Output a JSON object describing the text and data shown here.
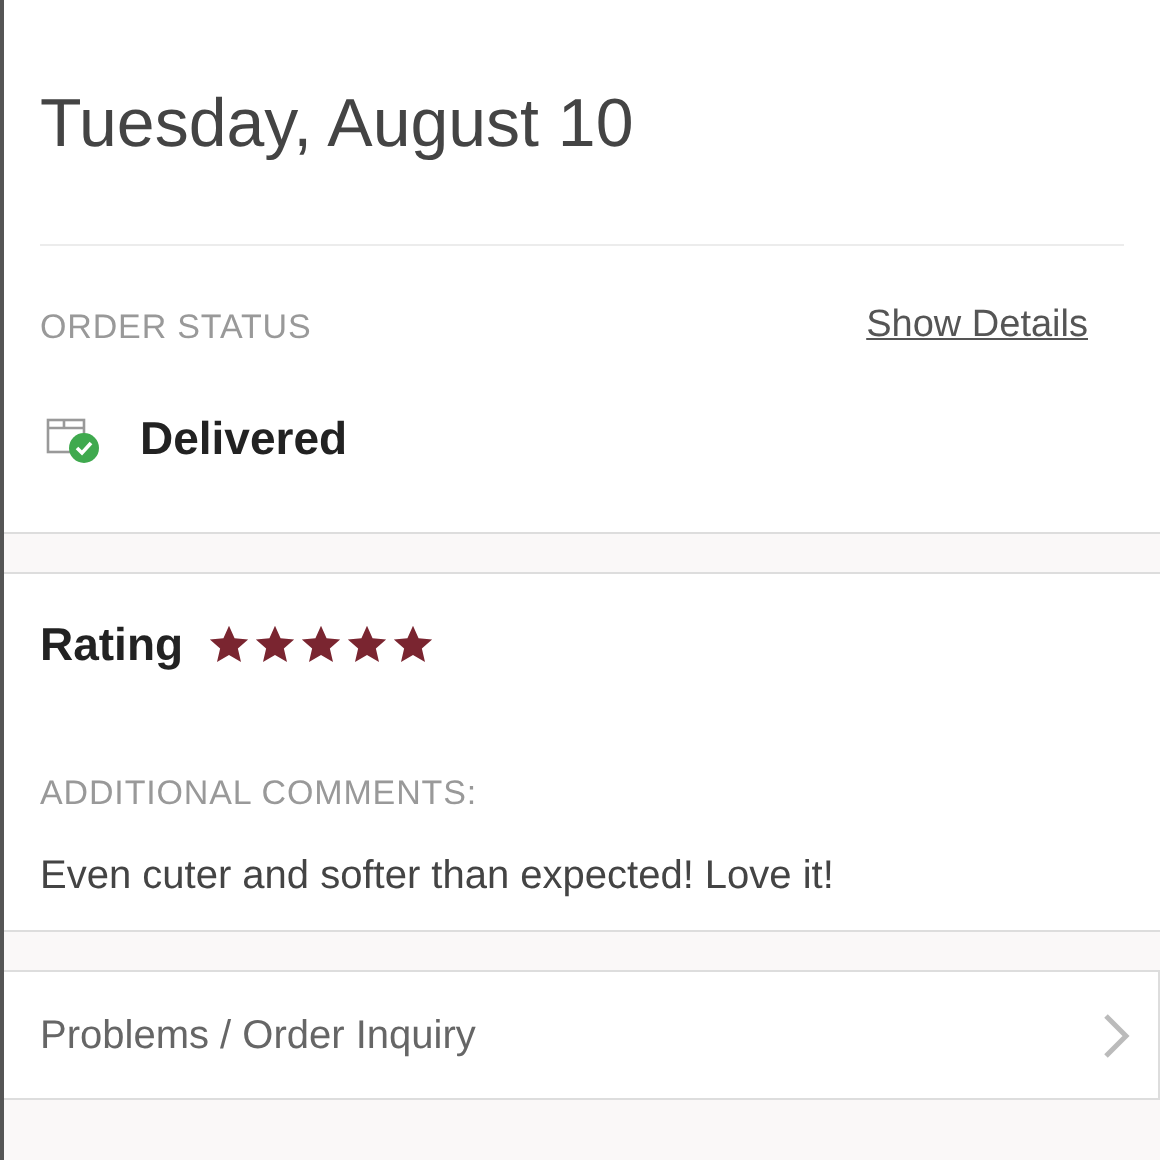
{
  "delivery": {
    "date": "Tuesday, August 10"
  },
  "order_status": {
    "label": "ORDER STATUS",
    "link": "Show Details",
    "status": "Delivered"
  },
  "rating": {
    "label": "Rating",
    "stars": 5
  },
  "comments": {
    "label": "ADDITIONAL COMMENTS:",
    "text": "Even cuter and softer than expected! Love it!"
  },
  "inquiry": {
    "label": "Problems / Order Inquiry"
  }
}
